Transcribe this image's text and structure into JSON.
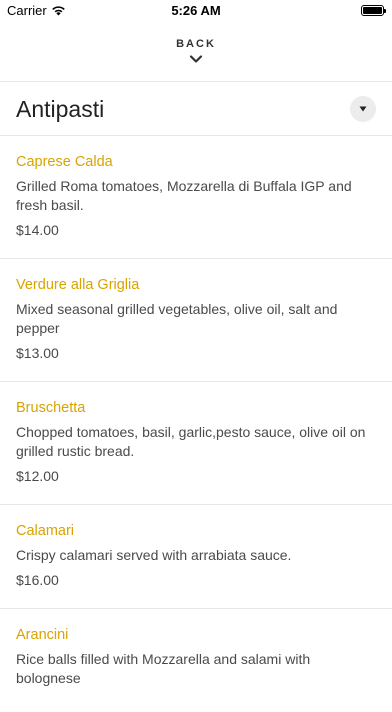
{
  "status_bar": {
    "carrier": "Carrier",
    "time": "5:26 AM"
  },
  "nav": {
    "back_label": "BACK"
  },
  "section": {
    "title": "Antipasti"
  },
  "menu_items": [
    {
      "name": "Caprese Calda",
      "description": "Grilled Roma tomatoes, Mozzarella di Buffala IGP and fresh basil.",
      "price": "$14.00"
    },
    {
      "name": "Verdure alla Griglia",
      "description": "Mixed seasonal grilled vegetables, olive oil, salt and pepper",
      "price": "$13.00"
    },
    {
      "name": "Bruschetta",
      "description": "Chopped tomatoes, basil, garlic,pesto sauce, olive oil on grilled rustic bread.",
      "price": "$12.00"
    },
    {
      "name": "Calamari",
      "description": "Crispy calamari served with arrabiata sauce.",
      "price": "$16.00"
    },
    {
      "name": "Arancini",
      "description": "Rice balls filled with Mozzarella and salami with bolognese",
      "price": ""
    }
  ],
  "icons": {
    "wifi": "wifi-icon",
    "battery": "battery-icon",
    "chevron": "chevron-down-icon",
    "dropdown": "triangle-down-icon"
  },
  "colors": {
    "accent": "#d9a300",
    "text": "#4a4a4a",
    "divider": "#e6e6e6"
  }
}
